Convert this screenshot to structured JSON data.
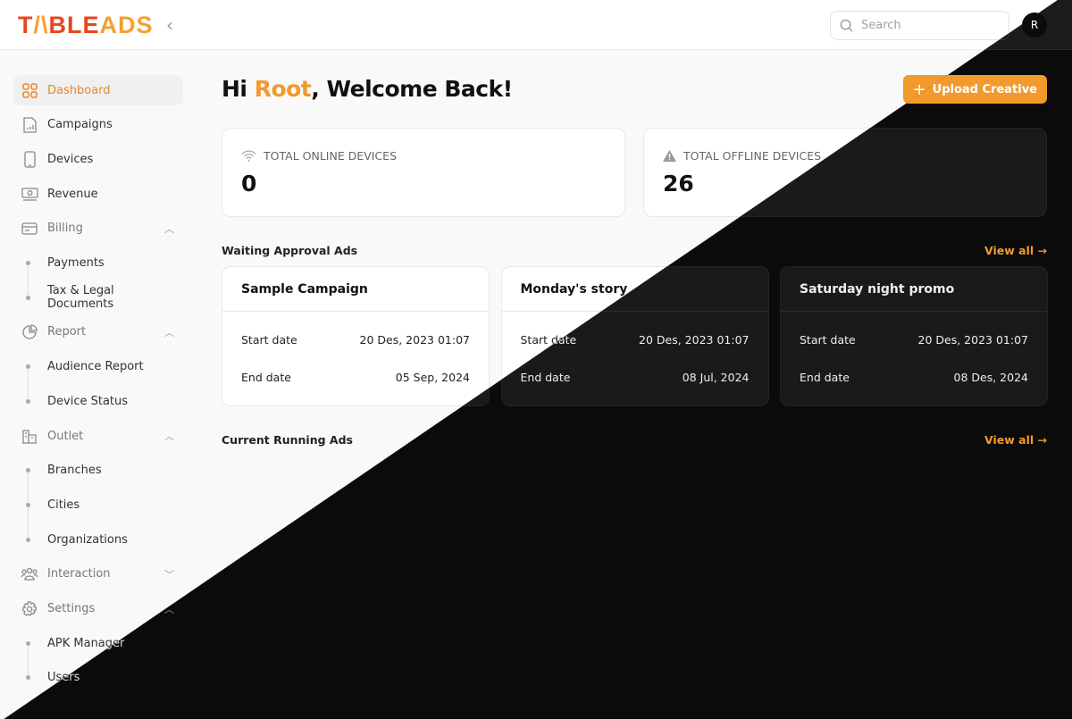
{
  "brand": {
    "logo_text": "TABLEADS",
    "accent": "#f29a2e",
    "logo_red": "#e8451f"
  },
  "header": {
    "search_placeholder": "Search",
    "avatar_initial": "R"
  },
  "sidebar": {
    "items": [
      {
        "label": "Dashboard",
        "icon": "grid-icon",
        "type": "item",
        "active": true
      },
      {
        "label": "Campaigns",
        "icon": "file-chart-icon",
        "type": "item"
      },
      {
        "label": "Devices",
        "icon": "smartphone-icon",
        "type": "item"
      },
      {
        "label": "Revenue",
        "icon": "money-icon",
        "type": "item"
      },
      {
        "label": "Billing",
        "icon": "credit-card-icon",
        "type": "group",
        "expanded": true
      },
      {
        "label": "Payments",
        "type": "sub"
      },
      {
        "label": "Tax & Legal Documents",
        "type": "sub"
      },
      {
        "label": "Report",
        "icon": "pie-chart-icon",
        "type": "group",
        "expanded": true
      },
      {
        "label": "Audience Report",
        "type": "sub"
      },
      {
        "label": "Device Status",
        "type": "sub"
      },
      {
        "label": "Outlet",
        "icon": "building-icon",
        "type": "group",
        "expanded": true
      },
      {
        "label": "Branches",
        "type": "sub"
      },
      {
        "label": "Cities",
        "type": "sub"
      },
      {
        "label": "Organizations",
        "type": "sub"
      },
      {
        "label": "Interaction",
        "icon": "users-icon",
        "type": "group",
        "expanded": false
      },
      {
        "label": "Settings",
        "icon": "gear-icon",
        "type": "group",
        "expanded": true
      },
      {
        "label": "APK Manager",
        "type": "sub"
      },
      {
        "label": "Users",
        "type": "sub"
      }
    ]
  },
  "main": {
    "greeting": "Hi ",
    "user_name": "Root",
    "greeting_rest": ", Welcome Back!",
    "upload_label": "Upload Creative",
    "stats": [
      {
        "label": "TOTAL ONLINE DEVICES",
        "value": "0",
        "icon": "wifi-icon"
      },
      {
        "label": "TOTAL OFFLINE DEVICES",
        "value": "26",
        "icon": "warning-icon"
      }
    ],
    "waiting_title": "Waiting Approval Ads",
    "running_title": "Current Running Ads",
    "view_all": "View all →",
    "start_label": "Start date",
    "end_label": "End date",
    "ads": [
      {
        "title": "Sample Campaign",
        "start": "20 Des, 2023 01:07",
        "end": "05 Sep, 2024"
      },
      {
        "title": "Monday's story",
        "start": "20 Des, 2023 01:07",
        "end": "08 Jul, 2024"
      },
      {
        "title": "Saturday night promo",
        "start": "20 Des, 2023 01:07",
        "end": "08 Des, 2024"
      }
    ]
  }
}
